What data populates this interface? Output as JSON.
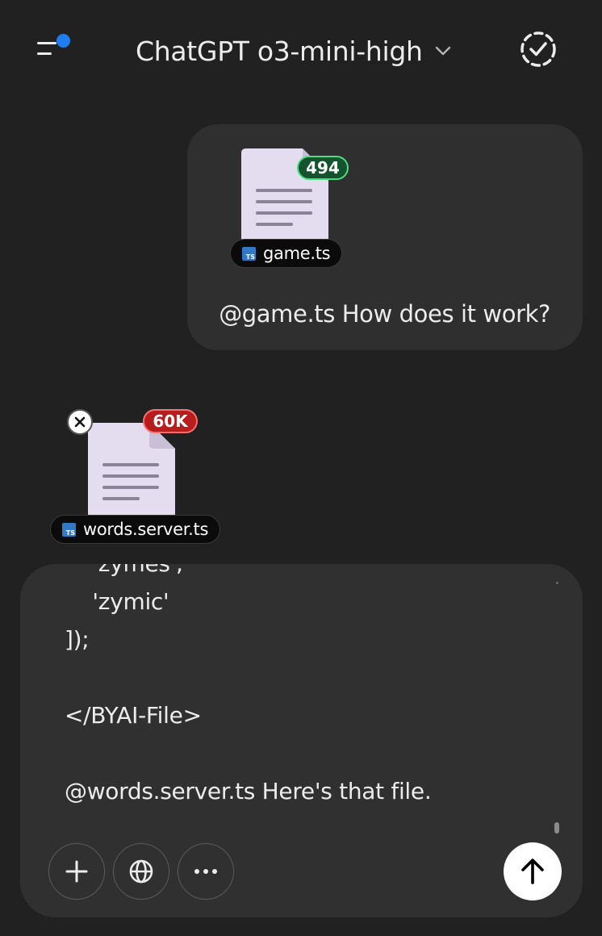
{
  "header": {
    "title": "ChatGPT o3-mini-high",
    "menu_icon": "sidebar-menu-icon",
    "notification_color": "#1e7ef0",
    "model_dropdown_icon": "chevron-down-icon",
    "temporary_chat_icon": "dashed-check-circle-icon"
  },
  "user_message": {
    "attachment": {
      "file_name": "game.ts",
      "token_count": "494",
      "badge_color": "#14532d",
      "file_type_icon": "typescript-icon"
    },
    "text": "@game.ts How does it work?"
  },
  "pending_attachment": {
    "file_name": "words.server.ts",
    "token_count": "60K",
    "badge_color": "#b91c1c",
    "file_type_icon": "typescript-icon",
    "remove_icon": "close-icon"
  },
  "composer": {
    "lines": [
      "    'zymes',",
      "    'zymic'",
      "]);",
      "",
      "</BYAI-File>",
      "",
      "@words.server.ts Here's that file."
    ],
    "buttons": {
      "add_icon": "plus-icon",
      "search_icon": "globe-icon",
      "more_icon": "more-horizontal-icon",
      "send_icon": "arrow-up-icon"
    }
  }
}
